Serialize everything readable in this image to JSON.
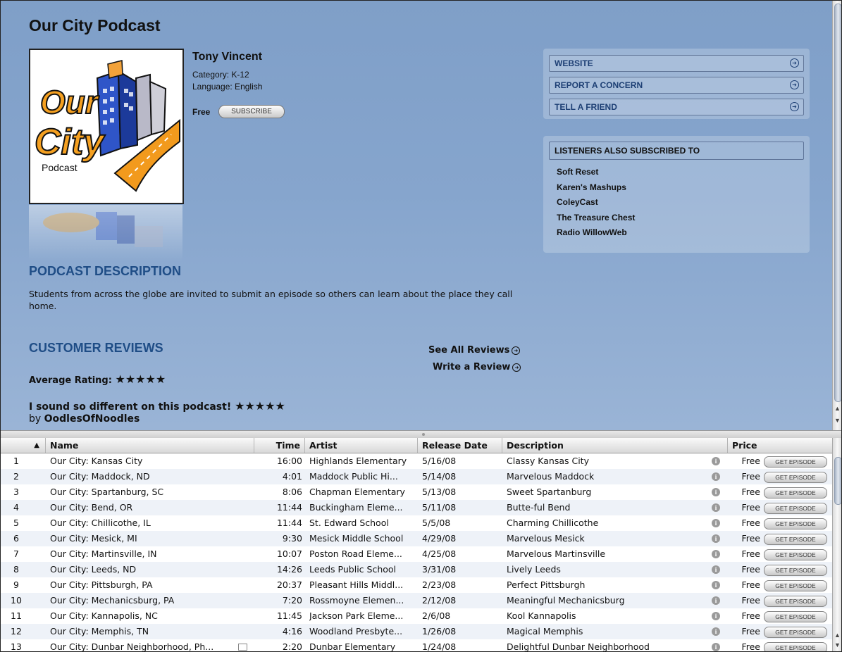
{
  "page": {
    "title": "Our City Podcast",
    "author": "Tony Vincent",
    "category": "Category: K-12",
    "language": "Language: English",
    "price": "Free",
    "subscribe_label": "SUBSCRIBE"
  },
  "links": [
    {
      "label": "WEBSITE"
    },
    {
      "label": "REPORT A CONCERN"
    },
    {
      "label": "TELL A FRIEND"
    }
  ],
  "also": {
    "heading": "LISTENERS ALSO SUBSCRIBED TO",
    "items": [
      "Soft Reset",
      "Karen's Mashups",
      "ColeyCast",
      "The Treasure Chest",
      "Radio WillowWeb"
    ]
  },
  "description": {
    "heading": "PODCAST DESCRIPTION",
    "text": "Students from across the globe are invited to submit an episode so others can learn about the place they call home."
  },
  "reviews": {
    "heading": "CUSTOMER REVIEWS",
    "see_all": "See All Reviews",
    "write": "Write a Review",
    "avg_label": "Average Rating:",
    "avg_stars": "★★★★★",
    "review_title": "I sound so different on this podcast!",
    "review_stars": "★★★★★",
    "by_prefix": "by",
    "reviewer": "OodlesOfNoodles"
  },
  "artwork": {
    "line1": "Our",
    "line2": "City",
    "caption": "Podcast"
  },
  "table": {
    "headers": {
      "sort": "▲",
      "name": "Name",
      "time": "Time",
      "artist": "Artist",
      "release": "Release Date",
      "description": "Description",
      "price": "Price"
    },
    "get_label": "GET EPISODE",
    "rows": [
      {
        "n": "1",
        "name": "Our City: Kansas City",
        "time": "16:00",
        "artist": "Highlands Elementary",
        "date": "5/16/08",
        "desc": "Classy Kansas City",
        "price": "Free"
      },
      {
        "n": "2",
        "name": "Our City: Maddock, ND",
        "time": "4:01",
        "artist": "Maddock Public Hi...",
        "date": "5/14/08",
        "desc": "Marvelous Maddock",
        "price": "Free"
      },
      {
        "n": "3",
        "name": "Our City: Spartanburg, SC",
        "time": "8:06",
        "artist": "Chapman Elementary",
        "date": "5/13/08",
        "desc": "Sweet Spartanburg",
        "price": "Free"
      },
      {
        "n": "4",
        "name": "Our City: Bend, OR",
        "time": "11:44",
        "artist": "Buckingham Eleme...",
        "date": "5/11/08",
        "desc": "Butte-ful Bend",
        "price": "Free"
      },
      {
        "n": "5",
        "name": "Our City: Chillicothe, IL",
        "time": "11:44",
        "artist": "St. Edward School",
        "date": "5/5/08",
        "desc": "Charming Chillicothe",
        "price": "Free"
      },
      {
        "n": "6",
        "name": "Our City: Mesick, MI",
        "time": "9:30",
        "artist": "Mesick Middle School",
        "date": "4/29/08",
        "desc": "Marvelous Mesick",
        "price": "Free"
      },
      {
        "n": "7",
        "name": "Our City: Martinsville, IN",
        "time": "10:07",
        "artist": "Poston Road Eleme...",
        "date": "4/25/08",
        "desc": "Marvelous Martinsville",
        "price": "Free"
      },
      {
        "n": "8",
        "name": "Our City: Leeds, ND",
        "time": "14:26",
        "artist": "Leeds Public School",
        "date": "3/31/08",
        "desc": "Lively Leeds",
        "price": "Free"
      },
      {
        "n": "9",
        "name": "Our City: Pittsburgh, PA",
        "time": "20:37",
        "artist": "Pleasant Hills Middl...",
        "date": "2/23/08",
        "desc": "Perfect Pittsburgh",
        "price": "Free"
      },
      {
        "n": "10",
        "name": "Our City: Mechanicsburg, PA",
        "time": "7:20",
        "artist": "Rossmoyne Elemen...",
        "date": "2/12/08",
        "desc": "Meaningful Mechanicsburg",
        "price": "Free"
      },
      {
        "n": "11",
        "name": "Our City: Kannapolis, NC",
        "time": "11:45",
        "artist": "Jackson Park Eleme...",
        "date": "2/6/08",
        "desc": "Kool Kannapolis",
        "price": "Free"
      },
      {
        "n": "12",
        "name": "Our City: Memphis, TN",
        "time": "4:16",
        "artist": "Woodland Presbyte...",
        "date": "1/26/08",
        "desc": "Magical Memphis",
        "price": "Free"
      },
      {
        "n": "13",
        "name": "Our City: Dunbar Neighborhood, Ph...",
        "time": "2:20",
        "artist": "Dunbar Elementary",
        "date": "1/24/08",
        "desc": "Delightful Dunbar Neighborhood",
        "price": "Free"
      }
    ]
  }
}
